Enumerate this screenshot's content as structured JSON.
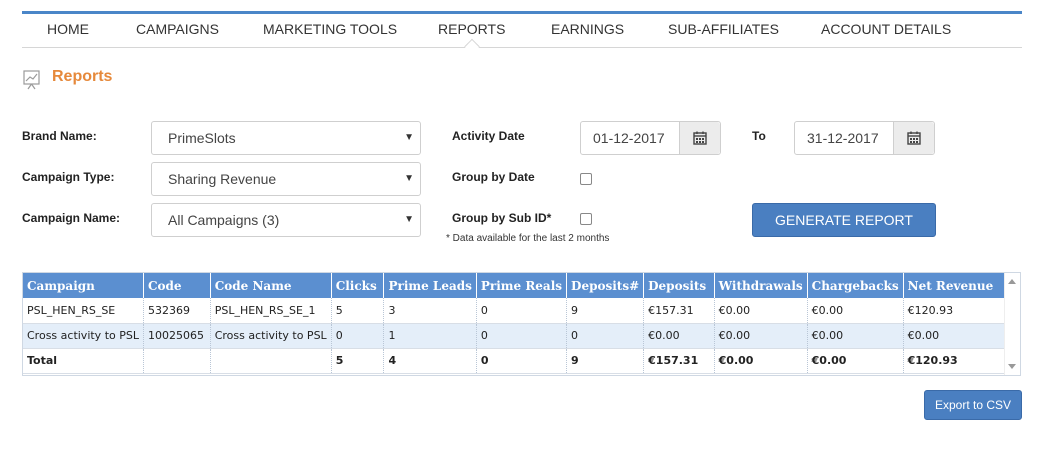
{
  "nav": {
    "items": [
      {
        "label": "HOME",
        "active": false
      },
      {
        "label": "CAMPAIGNS",
        "active": false
      },
      {
        "label": "MARKETING TOOLS",
        "active": false
      },
      {
        "label": "REPORTS",
        "active": true
      },
      {
        "label": "EARNINGS",
        "active": false
      },
      {
        "label": "SUB-AFFILIATES",
        "active": false
      },
      {
        "label": "ACCOUNT DETAILS",
        "active": false
      }
    ]
  },
  "page": {
    "title": "Reports",
    "title_color": "#e6893b",
    "icon": "chart-icon"
  },
  "form": {
    "brand_label": "Brand Name:",
    "brand_value": "PrimeSlots",
    "campaign_type_label": "Campaign Type:",
    "campaign_type_value": "Sharing Revenue",
    "campaign_name_label": "Campaign Name:",
    "campaign_name_value": "All Campaigns (3)",
    "activity_date_label": "Activity Date",
    "date_from": "01-12-2017",
    "to_label": "To",
    "date_to": "31-12-2017",
    "group_by_date_label": "Group by Date",
    "group_by_subid_label": "Group by Sub ID*",
    "note": "* Data available for the last 2 months",
    "generate_label": "GENERATE REPORT"
  },
  "table": {
    "headers": [
      "Campaign",
      "Code",
      "Code Name",
      "Clicks",
      "Prime Leads",
      "Prime Reals",
      "Deposits#",
      "Deposits",
      "Withdrawals",
      "Chargebacks",
      "Net Revenue"
    ],
    "rows": [
      [
        "PSL_HEN_RS_SE",
        "532369",
        "PSL_HEN_RS_SE_1",
        "5",
        "3",
        "0",
        "9",
        "€157.31",
        "€0.00",
        "€0.00",
        "€120.93"
      ],
      [
        "Cross activity to PSL",
        "10025065",
        "Cross activity to PSL",
        "0",
        "1",
        "0",
        "0",
        "€0.00",
        "€0.00",
        "€0.00",
        "€0.00"
      ]
    ],
    "total": [
      "Total",
      "",
      "",
      "5",
      "4",
      "0",
      "9",
      "€157.31",
      "€0.00",
      "€0.00",
      "€120.93"
    ]
  },
  "export": {
    "label": "Export to CSV"
  },
  "colors": {
    "accent": "#4a86c8",
    "header_bg": "#5b8fd0",
    "button_bg": "#4a7fc1",
    "alt_row": "#e4eef9"
  }
}
